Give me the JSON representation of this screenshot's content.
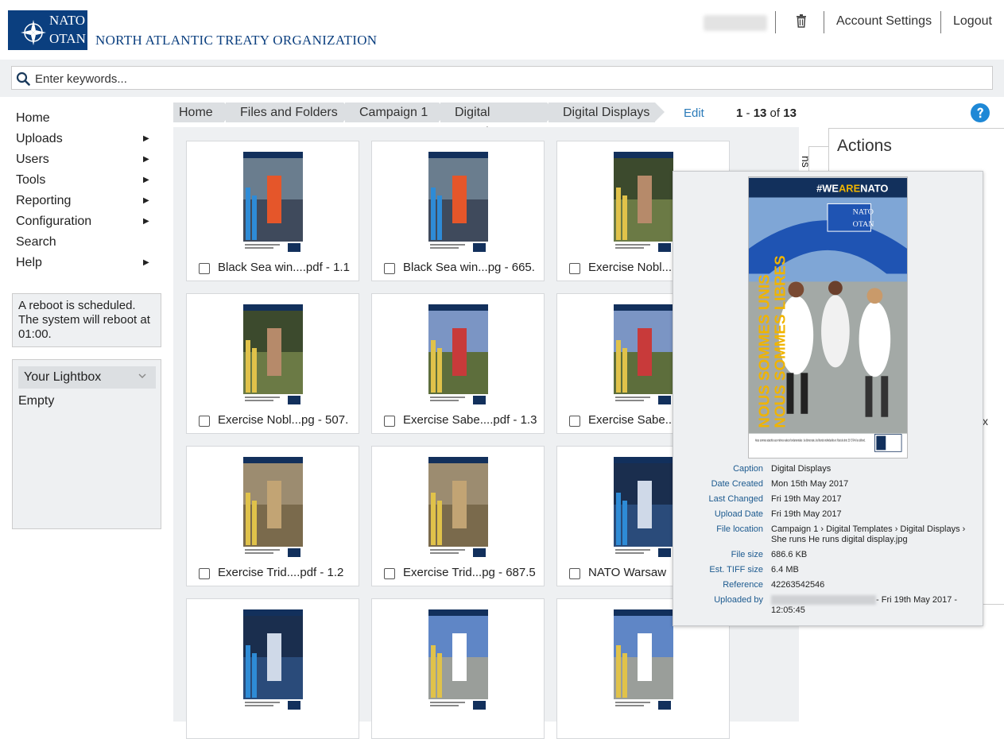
{
  "header": {
    "logo_line1": "NATO",
    "logo_line2": "OTAN",
    "org_name": "NORTH ATLANTIC TREATY ORGANIZATION",
    "account_settings": "Account Settings",
    "logout": "Logout",
    "brand_color": "#0b3f7f"
  },
  "search": {
    "placeholder": "Enter keywords..."
  },
  "sidebar": {
    "items": [
      {
        "label": "Home",
        "has_arrow": false
      },
      {
        "label": "Uploads",
        "has_arrow": true
      },
      {
        "label": "Users",
        "has_arrow": true
      },
      {
        "label": "Tools",
        "has_arrow": true
      },
      {
        "label": "Reporting",
        "has_arrow": true
      },
      {
        "label": "Configuration",
        "has_arrow": true
      },
      {
        "label": "Search",
        "has_arrow": false
      },
      {
        "label": "Help",
        "has_arrow": true
      }
    ],
    "arrow_glyph": "▶",
    "reboot_notice": "A reboot is scheduled. The system will reboot at 01:00.",
    "lightbox_label": "Your Lightbox",
    "lightbox_empty": "Empty"
  },
  "breadcrumb": {
    "items": [
      "Home",
      "Files and Folders",
      "Campaign 1",
      "Digital Templates",
      "Digital Displays"
    ],
    "edit": "Edit"
  },
  "pager": {
    "from": "1",
    "to": "13",
    "total": "13",
    "sep": "-",
    "of": "of"
  },
  "tiles": [
    {
      "label": "Black Sea win....pdf - 1.1",
      "theme": "sea"
    },
    {
      "label": "Black Sea win...pg - 665.",
      "theme": "sea"
    },
    {
      "label": "Exercise Nobl...",
      "theme": "soldier"
    },
    {
      "label": "Exercise Nobl...pg - 507.",
      "theme": "soldier"
    },
    {
      "label": "Exercise Sabe....pdf - 1.3",
      "theme": "flags"
    },
    {
      "label": "Exercise Sabe...",
      "theme": "flags"
    },
    {
      "label": "Exercise Trid....pdf - 1.2",
      "theme": "desert"
    },
    {
      "label": "Exercise Trid...pg - 687.5",
      "theme": "desert"
    },
    {
      "label": "NATO Warsaw",
      "theme": "summit"
    },
    {
      "label": "",
      "theme": "summit"
    },
    {
      "label": "",
      "theme": "run"
    },
    {
      "label": "",
      "theme": "run"
    }
  ],
  "actions": {
    "title": "Actions",
    "tab_label": "ns",
    "peek": "x"
  },
  "preview": {
    "hashtag_prefix": "#WE",
    "hashtag_highlight": "ARE",
    "hashtag_suffix": "NATO",
    "arch_label_1": "NATO",
    "arch_label_2": "OTAN",
    "slogan_1": "NOUS SOMMES UNIS",
    "slogan_2": "NOUS SOMMES LIBRES",
    "body_text": "Nous sommes attachés aux mêmes valeurs fondamentales : la démocratie, les libertés individuelles et l'état de droit. Et l'OTAN les défend.",
    "meta": [
      {
        "key": "Caption",
        "value": "Digital Displays"
      },
      {
        "key": "Date Created",
        "value": "Mon 15th May 2017"
      },
      {
        "key": "Last Changed",
        "value": "Fri 19th May 2017"
      },
      {
        "key": "Upload Date",
        "value": "Fri 19th May 2017"
      },
      {
        "key": "File location",
        "value": "Campaign 1 › Digital Templates › Digital Displays › She runs He runs digital display.jpg"
      },
      {
        "key": "File size",
        "value": "686.6 KB"
      },
      {
        "key": "Est. TIFF size",
        "value": "6.4 MB"
      },
      {
        "key": "Reference",
        "value": "42263542546"
      },
      {
        "key": "Uploaded by",
        "value": "- Fri 19th May 2017 - 12:05:45"
      }
    ]
  }
}
